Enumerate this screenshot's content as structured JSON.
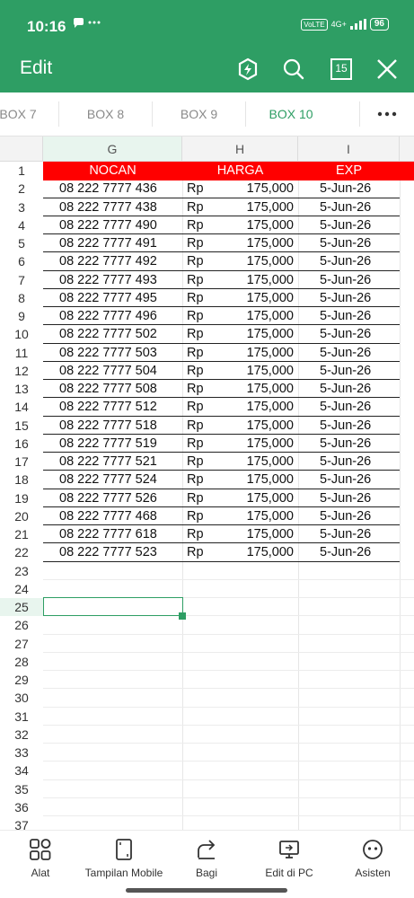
{
  "status_bar": {
    "time": "10:16",
    "network_type": "4G+",
    "sim_badge": "VoLTE",
    "battery": "96"
  },
  "app_bar": {
    "title": "Edit",
    "page_count": "15"
  },
  "sheet_tabs": [
    {
      "label": "BOX 7",
      "active": false
    },
    {
      "label": "BOX 8",
      "active": false
    },
    {
      "label": "BOX 9",
      "active": false
    },
    {
      "label": "BOX 10",
      "active": true
    }
  ],
  "columns": [
    "G",
    "H",
    "I"
  ],
  "header_row": {
    "nocan": "NOCAN",
    "harga": "HARGA",
    "exp": "EXP"
  },
  "rows": [
    {
      "num": "2",
      "nocan": "08 222 7777 436",
      "currency": "Rp",
      "harga": "175,000",
      "exp": "5-Jun-26"
    },
    {
      "num": "3",
      "nocan": "08 222 7777 438",
      "currency": "Rp",
      "harga": "175,000",
      "exp": "5-Jun-26"
    },
    {
      "num": "4",
      "nocan": "08 222 7777 490",
      "currency": "Rp",
      "harga": "175,000",
      "exp": "5-Jun-26"
    },
    {
      "num": "5",
      "nocan": "08 222 7777 491",
      "currency": "Rp",
      "harga": "175,000",
      "exp": "5-Jun-26"
    },
    {
      "num": "6",
      "nocan": "08 222 7777 492",
      "currency": "Rp",
      "harga": "175,000",
      "exp": "5-Jun-26"
    },
    {
      "num": "7",
      "nocan": "08 222 7777 493",
      "currency": "Rp",
      "harga": "175,000",
      "exp": "5-Jun-26"
    },
    {
      "num": "8",
      "nocan": "08 222 7777 495",
      "currency": "Rp",
      "harga": "175,000",
      "exp": "5-Jun-26"
    },
    {
      "num": "9",
      "nocan": "08 222 7777 496",
      "currency": "Rp",
      "harga": "175,000",
      "exp": "5-Jun-26"
    },
    {
      "num": "10",
      "nocan": "08 222 7777 502",
      "currency": "Rp",
      "harga": "175,000",
      "exp": "5-Jun-26"
    },
    {
      "num": "11",
      "nocan": "08 222 7777 503",
      "currency": "Rp",
      "harga": "175,000",
      "exp": "5-Jun-26"
    },
    {
      "num": "12",
      "nocan": "08 222 7777 504",
      "currency": "Rp",
      "harga": "175,000",
      "exp": "5-Jun-26"
    },
    {
      "num": "13",
      "nocan": "08 222 7777 508",
      "currency": "Rp",
      "harga": "175,000",
      "exp": "5-Jun-26"
    },
    {
      "num": "14",
      "nocan": "08 222 7777 512",
      "currency": "Rp",
      "harga": "175,000",
      "exp": "5-Jun-26"
    },
    {
      "num": "15",
      "nocan": "08 222 7777 518",
      "currency": "Rp",
      "harga": "175,000",
      "exp": "5-Jun-26"
    },
    {
      "num": "16",
      "nocan": "08 222 7777 519",
      "currency": "Rp",
      "harga": "175,000",
      "exp": "5-Jun-26"
    },
    {
      "num": "17",
      "nocan": "08 222 7777 521",
      "currency": "Rp",
      "harga": "175,000",
      "exp": "5-Jun-26"
    },
    {
      "num": "18",
      "nocan": "08 222 7777 524",
      "currency": "Rp",
      "harga": "175,000",
      "exp": "5-Jun-26"
    },
    {
      "num": "19",
      "nocan": "08 222 7777 526",
      "currency": "Rp",
      "harga": "175,000",
      "exp": "5-Jun-26"
    },
    {
      "num": "20",
      "nocan": "08 222 7777 468",
      "currency": "Rp",
      "harga": "175,000",
      "exp": "5-Jun-26"
    },
    {
      "num": "21",
      "nocan": "08 222 7777 618",
      "currency": "Rp",
      "harga": "175,000",
      "exp": "5-Jun-26"
    },
    {
      "num": "22",
      "nocan": "08 222 7777 523",
      "currency": "Rp",
      "harga": "175,000",
      "exp": "5-Jun-26"
    }
  ],
  "empty_row_numbers": [
    "23",
    "24",
    "25",
    "26",
    "27",
    "28",
    "29",
    "30",
    "31",
    "32",
    "33",
    "34",
    "35",
    "36",
    "37"
  ],
  "selected_row": "25",
  "toolbar": [
    {
      "label": "Alat",
      "icon": "grid-tools-icon"
    },
    {
      "label": "Tampilan Mobile",
      "icon": "mobile-view-icon"
    },
    {
      "label": "Bagi",
      "icon": "share-icon"
    },
    {
      "label": "Edit di PC",
      "icon": "pc-monitor-icon"
    },
    {
      "label": "Asisten",
      "icon": "assistant-icon"
    }
  ],
  "colors": {
    "accent": "#2e9e64",
    "header_fill": "#ff0000"
  }
}
